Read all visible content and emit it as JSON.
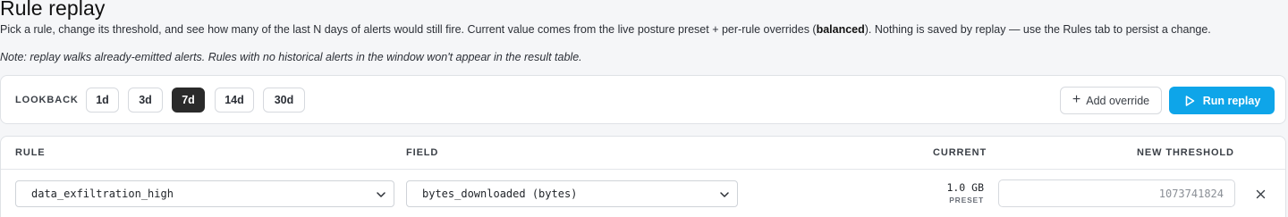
{
  "header": {
    "title": "Rule replay",
    "desc_a": "Pick a rule, change its threshold, and see how many of the last N days of alerts would still fire. Current value comes from the live posture preset + per-rule overrides (",
    "desc_bold": "balanced",
    "desc_b": "). Nothing is saved by replay — use the Rules tab to persist a change.",
    "note": "Note: replay walks already-emitted alerts. Rules with no historical alerts in the window won't appear in the result table."
  },
  "lookback": {
    "label": "LOOKBACK",
    "options": [
      "1d",
      "3d",
      "7d",
      "14d",
      "30d"
    ],
    "selected": "7d"
  },
  "actions": {
    "add_override": "Add override",
    "run_replay": "Run replay"
  },
  "table": {
    "headers": {
      "rule": "RULE",
      "field": "FIELD",
      "current": "CURRENT",
      "new_threshold": "NEW THRESHOLD"
    },
    "rows": [
      {
        "rule": "data_exfiltration_high",
        "field": "bytes_downloaded (bytes)",
        "current_value": "1.0 GB",
        "current_source": "PRESET",
        "threshold_placeholder": "1073741824"
      }
    ]
  },
  "icons": {
    "add": "plus-icon",
    "run": "play-icon",
    "select": "chevron-down-icon",
    "remove": "close-icon"
  },
  "colors": {
    "accent": "#0ea5e9",
    "chip_active": "#2a2a2a"
  }
}
